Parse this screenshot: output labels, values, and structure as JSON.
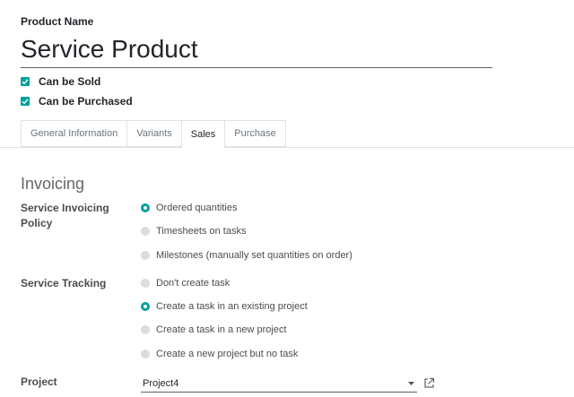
{
  "product": {
    "name_label": "Product Name",
    "name_value": "Service Product"
  },
  "checkboxes": [
    {
      "label": "Can be Sold",
      "checked": true
    },
    {
      "label": "Can be Purchased",
      "checked": true
    }
  ],
  "tabs": [
    {
      "label": "General Information",
      "active": false
    },
    {
      "label": "Variants",
      "active": false
    },
    {
      "label": "Sales",
      "active": true
    },
    {
      "label": "Purchase",
      "active": false
    }
  ],
  "invoicing": {
    "section_title": "Invoicing",
    "policy_label": "Service Invoicing Policy",
    "policy_options": [
      {
        "label": "Ordered quantities",
        "selected": true
      },
      {
        "label": "Timesheets on tasks",
        "selected": false
      },
      {
        "label": "Milestones (manually set quantities on order)",
        "selected": false
      }
    ],
    "tracking_label": "Service Tracking",
    "tracking_options": [
      {
        "label": "Don't create task",
        "selected": false
      },
      {
        "label": "Create a task in an existing project",
        "selected": true
      },
      {
        "label": "Create a task in a new project",
        "selected": false
      },
      {
        "label": "Create a new project but no task",
        "selected": false
      }
    ],
    "project_label": "Project",
    "project_value": "Project4"
  },
  "colors": {
    "accent": "#01a09c"
  },
  "icons": {
    "checkbox": "check-icon",
    "dropdown": "caret-down-icon",
    "external": "external-link-icon"
  }
}
